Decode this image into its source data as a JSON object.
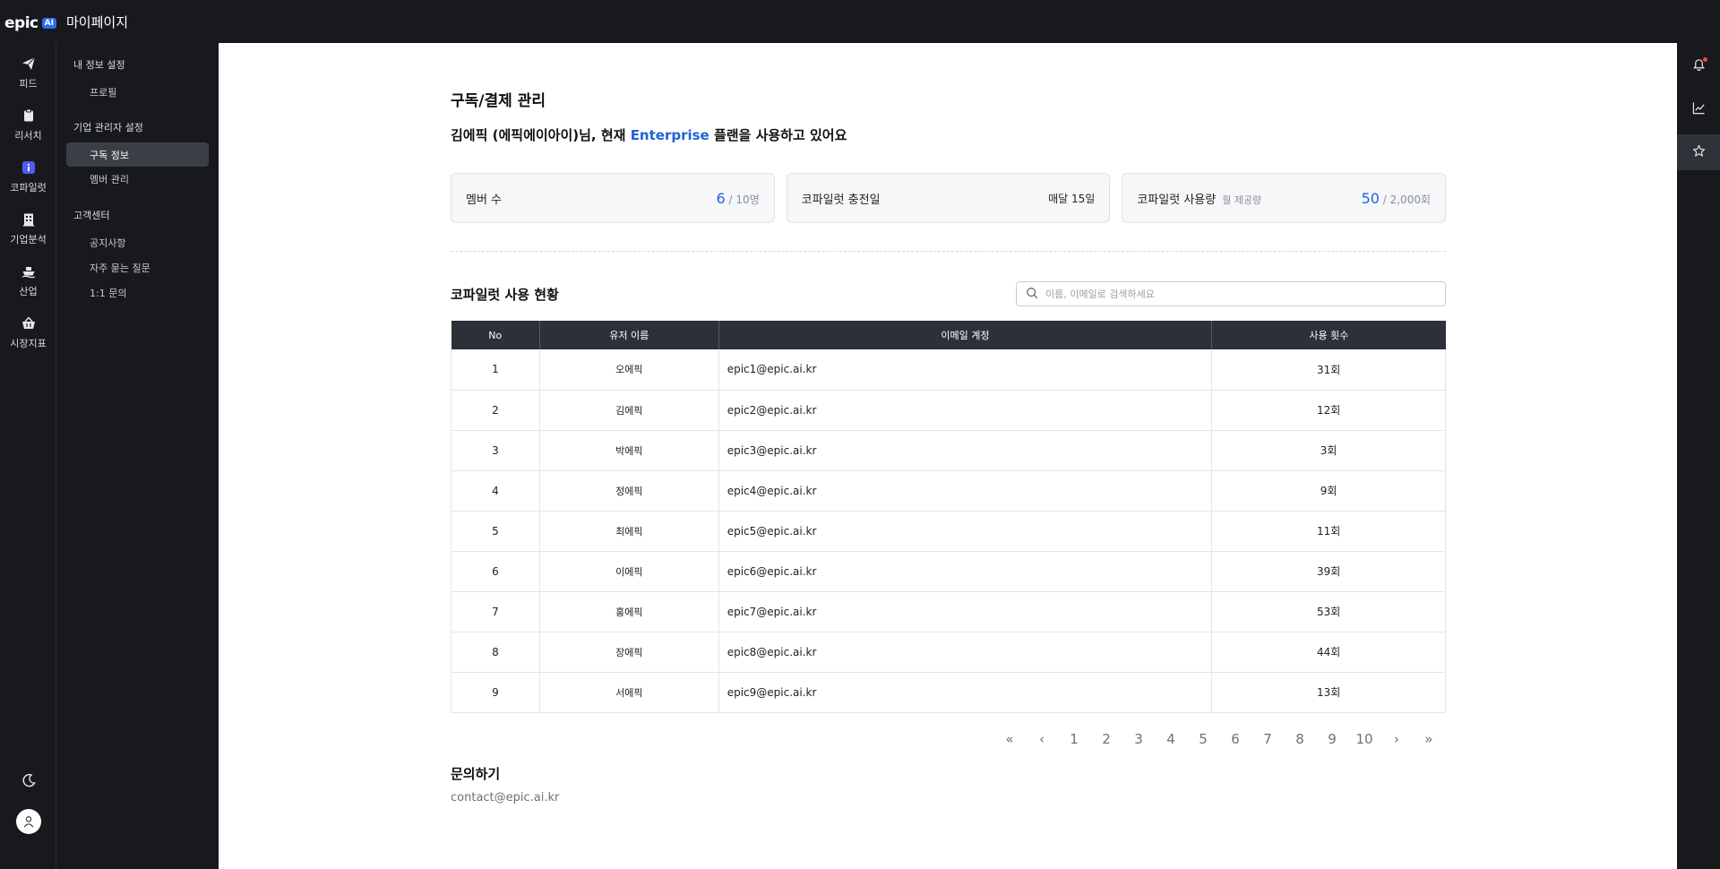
{
  "app": {
    "logo_text": "epic",
    "logo_badge": "AI",
    "title": "마이페이지"
  },
  "rail": {
    "items": [
      {
        "label": "피드",
        "icon": "paper-plane-icon"
      },
      {
        "label": "리서치",
        "icon": "clipboard-icon"
      },
      {
        "label": "코파일럿",
        "icon": "info-icon"
      },
      {
        "label": "기업분석",
        "icon": "building-icon"
      },
      {
        "label": "산업",
        "icon": "ship-icon"
      },
      {
        "label": "시장지표",
        "icon": "basket-icon"
      }
    ],
    "bottom": [
      "moon-icon",
      "avatar-icon"
    ]
  },
  "sidebar": {
    "sections": [
      {
        "title": "내 정보 설정",
        "items": [
          "프로필"
        ]
      },
      {
        "title": "기업 관리자 설정",
        "items": [
          "구독 정보",
          "멤버 관리"
        ]
      },
      {
        "title": "고객센터",
        "items": [
          "공지사항",
          "자주 묻는 질문",
          "1:1 문의"
        ]
      }
    ],
    "active": "구독 정보"
  },
  "right_rail": {
    "icons": [
      "bell-icon",
      "chart-icon",
      "star-icon"
    ],
    "accent": "#e94b4b"
  },
  "main": {
    "title": "구독/결제 관리",
    "greeting_prefix": "김에픽 (에픽에이아이)님, 현재 ",
    "plan": "Enterprise",
    "greeting_suffix": " 플랜을 사용하고 있어요",
    "plan_color": "#1f63d8",
    "cards": [
      {
        "label": "멤버 수",
        "sub": "",
        "value": "6",
        "limit": "/ 10명"
      },
      {
        "label": "코파일럿 충전일",
        "sub": "",
        "text": "매달 15일"
      },
      {
        "label": "코파일럿 사용량",
        "sub": "월 제공량",
        "value": "50",
        "limit": "/ 2,000회"
      }
    ],
    "usage_title": "코파일럿 사용 현황",
    "search_placeholder": "이름, 이메일로 검색하세요",
    "table": {
      "headers": [
        "No",
        "유저 이름",
        "이메일 계정",
        "사용 횟수"
      ],
      "rows": [
        {
          "no": "1",
          "name": "오에픽",
          "email": "epic1@epic.ai.kr",
          "count": "31회"
        },
        {
          "no": "2",
          "name": "김에픽",
          "email": "epic2@epic.ai.kr",
          "count": "12회"
        },
        {
          "no": "3",
          "name": "박에픽",
          "email": "epic3@epic.ai.kr",
          "count": "3회"
        },
        {
          "no": "4",
          "name": "정에픽",
          "email": "epic4@epic.ai.kr",
          "count": "9회"
        },
        {
          "no": "5",
          "name": "최에픽",
          "email": "epic5@epic.ai.kr",
          "count": "11회"
        },
        {
          "no": "6",
          "name": "이에픽",
          "email": "epic6@epic.ai.kr",
          "count": "39회"
        },
        {
          "no": "7",
          "name": "홍에픽",
          "email": "epic7@epic.ai.kr",
          "count": "53회"
        },
        {
          "no": "8",
          "name": "장에픽",
          "email": "epic8@epic.ai.kr",
          "count": "44회"
        },
        {
          "no": "9",
          "name": "서에픽",
          "email": "epic9@epic.ai.kr",
          "count": "13회"
        }
      ]
    },
    "pagination": [
      "«",
      "‹",
      "1",
      "2",
      "3",
      "4",
      "5",
      "6",
      "7",
      "8",
      "9",
      "10",
      "›",
      "»"
    ],
    "contact_title": "문의하기",
    "contact_email": "contact@epic.ai.kr"
  }
}
